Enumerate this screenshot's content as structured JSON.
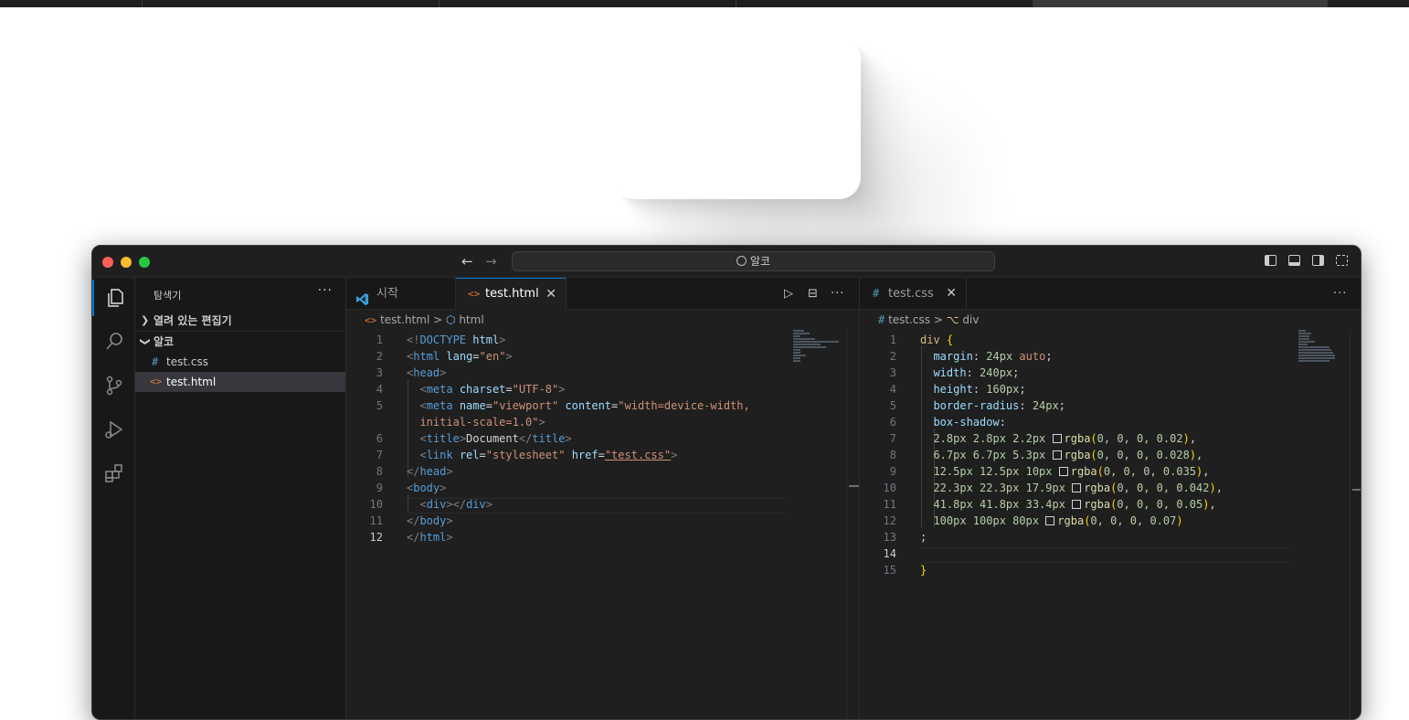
{
  "top_strip": {
    "tab_count": 5
  },
  "window": {
    "command_center": "알코",
    "nav_back": "←",
    "nav_forward": "→"
  },
  "activity_bar": {
    "items": [
      "explorer-icon",
      "search-icon",
      "source-control-icon",
      "run-debug-icon",
      "extensions-icon"
    ],
    "active": "explorer-icon"
  },
  "sidebar": {
    "title": "탐색기",
    "more": "···",
    "open_editors_label": "열려 있는 편집기",
    "folder_label": "알코",
    "files": [
      {
        "name": "test.css",
        "icon": "#"
      },
      {
        "name": "test.html",
        "icon": "<>"
      }
    ],
    "selected_file": "test.html"
  },
  "editor_left": {
    "tabs": [
      {
        "label": "시작",
        "icon": "vscode-logo-icon"
      },
      {
        "label": "test.html",
        "icon": "<>",
        "close": "✕"
      }
    ],
    "actions": {
      "run": "▷",
      "split": "⊟",
      "more": "···"
    },
    "breadcrumb": [
      "test.html",
      "html"
    ],
    "breadcrumb_sep": ">",
    "current_line": 12,
    "line_numbers": [
      "1",
      "2",
      "3",
      "4",
      "5",
      "",
      "6",
      "7",
      "8",
      "9",
      "10",
      "11",
      "12"
    ],
    "lines": [
      [
        [
          "pu",
          "<!"
        ],
        [
          "tg",
          "DOCTYPE"
        ],
        [
          "tx",
          " "
        ],
        [
          "at",
          "html"
        ],
        [
          "pu",
          ">"
        ]
      ],
      [
        [
          "pu",
          "<"
        ],
        [
          "tg",
          "html"
        ],
        [
          "tx",
          " "
        ],
        [
          "at",
          "lang"
        ],
        [
          "tx",
          "="
        ],
        [
          "st",
          "\"en\""
        ],
        [
          "pu",
          ">"
        ]
      ],
      [
        [
          "pu",
          "<"
        ],
        [
          "tg",
          "head"
        ],
        [
          "pu",
          ">"
        ]
      ],
      [
        [
          "tx",
          "  "
        ],
        [
          "pu",
          "<"
        ],
        [
          "tg",
          "meta"
        ],
        [
          "tx",
          " "
        ],
        [
          "at",
          "charset"
        ],
        [
          "tx",
          "="
        ],
        [
          "st",
          "\"UTF-8\""
        ],
        [
          "pu",
          ">"
        ]
      ],
      [
        [
          "tx",
          "  "
        ],
        [
          "pu",
          "<"
        ],
        [
          "tg",
          "meta"
        ],
        [
          "tx",
          " "
        ],
        [
          "at",
          "name"
        ],
        [
          "tx",
          "="
        ],
        [
          "st",
          "\"viewport\""
        ],
        [
          "tx",
          " "
        ],
        [
          "at",
          "content"
        ],
        [
          "tx",
          "="
        ],
        [
          "st",
          "\"width=device-width,"
        ]
      ],
      [
        [
          "tx",
          "  "
        ],
        [
          "st",
          "initial-scale=1.0\""
        ],
        [
          "pu",
          ">"
        ]
      ],
      [
        [
          "tx",
          "  "
        ],
        [
          "pu",
          "<"
        ],
        [
          "tg",
          "title"
        ],
        [
          "pu",
          ">"
        ],
        [
          "tx",
          "Document"
        ],
        [
          "pu",
          "</"
        ],
        [
          "tg",
          "title"
        ],
        [
          "pu",
          ">"
        ]
      ],
      [
        [
          "tx",
          "  "
        ],
        [
          "pu",
          "<"
        ],
        [
          "tg",
          "link"
        ],
        [
          "tx",
          " "
        ],
        [
          "at",
          "rel"
        ],
        [
          "tx",
          "="
        ],
        [
          "st",
          "\"stylesheet\""
        ],
        [
          "tx",
          " "
        ],
        [
          "at",
          "href"
        ],
        [
          "tx",
          "="
        ],
        [
          "st",
          "\"test.css\""
        ],
        [
          "pu",
          ">"
        ]
      ],
      [
        [
          "pu",
          "</"
        ],
        [
          "tg",
          "head"
        ],
        [
          "pu",
          ">"
        ]
      ],
      [
        [
          "pu",
          "<"
        ],
        [
          "tg",
          "body"
        ],
        [
          "pu",
          ">"
        ]
      ],
      [
        [
          "tx",
          "  "
        ],
        [
          "pu",
          "<"
        ],
        [
          "tg",
          "div"
        ],
        [
          "pu",
          "></"
        ],
        [
          "tg",
          "div"
        ],
        [
          "pu",
          ">"
        ]
      ],
      [
        [
          "pu",
          "</"
        ],
        [
          "tg",
          "body"
        ],
        [
          "pu",
          ">"
        ]
      ],
      [
        [
          "pu",
          "</"
        ],
        [
          "tg",
          "html"
        ],
        [
          "pu",
          ">"
        ]
      ]
    ]
  },
  "editor_right": {
    "tabs": [
      {
        "label": "test.css",
        "icon": "#",
        "close": "✕"
      }
    ],
    "actions": {
      "more": "···"
    },
    "breadcrumb": [
      "test.css",
      "div"
    ],
    "breadcrumb_sep": ">",
    "current_line": 14,
    "line_numbers": [
      "1",
      "2",
      "3",
      "4",
      "5",
      "6",
      "7",
      "8",
      "9",
      "10",
      "11",
      "12",
      "13",
      "14",
      "15"
    ],
    "lines": [
      [
        [
          "sel_",
          "div"
        ],
        [
          "tx",
          " "
        ],
        [
          "br",
          "{"
        ]
      ],
      [
        [
          "tx",
          "  "
        ],
        [
          "pr",
          "margin"
        ],
        [
          "tx",
          ": "
        ],
        [
          "nu",
          "24px"
        ],
        [
          "tx",
          " "
        ],
        [
          "kw",
          "auto"
        ],
        [
          "tx",
          ";"
        ]
      ],
      [
        [
          "tx",
          "  "
        ],
        [
          "pr",
          "width"
        ],
        [
          "tx",
          ": "
        ],
        [
          "nu",
          "240px"
        ],
        [
          "tx",
          ";"
        ]
      ],
      [
        [
          "tx",
          "  "
        ],
        [
          "pr",
          "height"
        ],
        [
          "tx",
          ": "
        ],
        [
          "nu",
          "160px"
        ],
        [
          "tx",
          ";"
        ]
      ],
      [
        [
          "tx",
          "  "
        ],
        [
          "pr",
          "border-radius"
        ],
        [
          "tx",
          ": "
        ],
        [
          "nu",
          "24px"
        ],
        [
          "tx",
          ";"
        ]
      ],
      [
        [
          "tx",
          "  "
        ],
        [
          "pr",
          "box-shadow"
        ],
        [
          "tx",
          ":"
        ]
      ],
      [
        [
          "tx",
          "  "
        ],
        [
          "nu",
          "2.8px 2.8px 2.2px"
        ],
        [
          "tx",
          " "
        ],
        [
          "sw",
          ""
        ],
        [
          "fn",
          "rgba"
        ],
        [
          "br",
          "("
        ],
        [
          "nu",
          "0, 0, 0, 0.02"
        ],
        [
          "br",
          ")"
        ],
        [
          "tx",
          ","
        ]
      ],
      [
        [
          "tx",
          "  "
        ],
        [
          "nu",
          "6.7px 6.7px 5.3px"
        ],
        [
          "tx",
          " "
        ],
        [
          "sw",
          ""
        ],
        [
          "fn",
          "rgba"
        ],
        [
          "br",
          "("
        ],
        [
          "nu",
          "0, 0, 0, 0.028"
        ],
        [
          "br",
          ")"
        ],
        [
          "tx",
          ","
        ]
      ],
      [
        [
          "tx",
          "  "
        ],
        [
          "nu",
          "12.5px 12.5px 10px"
        ],
        [
          "tx",
          " "
        ],
        [
          "sw",
          ""
        ],
        [
          "fn",
          "rgba"
        ],
        [
          "br",
          "("
        ],
        [
          "nu",
          "0, 0, 0, 0.035"
        ],
        [
          "br",
          ")"
        ],
        [
          "tx",
          ","
        ]
      ],
      [
        [
          "tx",
          "  "
        ],
        [
          "nu",
          "22.3px 22.3px 17.9px"
        ],
        [
          "tx",
          " "
        ],
        [
          "sw",
          ""
        ],
        [
          "fn",
          "rgba"
        ],
        [
          "br",
          "("
        ],
        [
          "nu",
          "0, 0, 0, 0.042"
        ],
        [
          "br",
          ")"
        ],
        [
          "tx",
          ","
        ]
      ],
      [
        [
          "tx",
          "  "
        ],
        [
          "nu",
          "41.8px 41.8px 33.4px"
        ],
        [
          "tx",
          " "
        ],
        [
          "sw",
          ""
        ],
        [
          "fn",
          "rgba"
        ],
        [
          "br",
          "("
        ],
        [
          "nu",
          "0, 0, 0, 0.05"
        ],
        [
          "br",
          ")"
        ],
        [
          "tx",
          ","
        ]
      ],
      [
        [
          "tx",
          "  "
        ],
        [
          "nu",
          "100px 100px 80px"
        ],
        [
          "tx",
          " "
        ],
        [
          "sw",
          ""
        ],
        [
          "fn",
          "rgba"
        ],
        [
          "br",
          "("
        ],
        [
          "nu",
          "0, 0, 0, 0.07"
        ],
        [
          "br",
          ")"
        ]
      ],
      [
        [
          "tx",
          ";"
        ]
      ],
      [
        [
          "tx",
          ""
        ]
      ],
      [
        [
          "br",
          "}"
        ]
      ]
    ]
  },
  "colors": {
    "accent": "#0078d4",
    "editor_bg": "#1f1f1f",
    "sidebar_bg": "#181818",
    "close_light": "#ff5f57",
    "min_light": "#febc2e",
    "max_light": "#28c840"
  }
}
